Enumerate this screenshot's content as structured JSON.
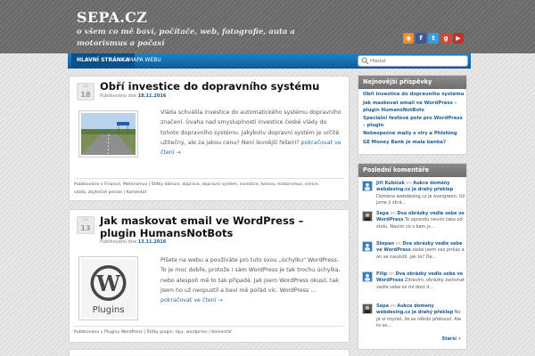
{
  "site": {
    "title": "SEPA.CZ",
    "tagline": "o všem co mě baví, počítače, web, fotografie, auta a motorismus a počasí"
  },
  "social_icons": [
    {
      "name": "rss-icon",
      "glyph": "◉",
      "color": "#f08c2a"
    },
    {
      "name": "facebook-icon",
      "glyph": "f",
      "color": "#3b5998"
    },
    {
      "name": "twitter-icon",
      "glyph": "t",
      "color": "#3a9ed9"
    },
    {
      "name": "googleplus-icon",
      "glyph": "g",
      "color": "#d34836"
    },
    {
      "name": "youtube-icon",
      "glyph": "▶",
      "color": "#c4302b"
    }
  ],
  "nav": {
    "home": "HLAVNÍ STRÁNKA",
    "map": "MAPA WEBU"
  },
  "search": {
    "placeholder": "Hledat"
  },
  "posts": [
    {
      "month": "Lis",
      "day": "18",
      "title": "Obří investice do dopravního systému",
      "meta_prefix": "Publikováno dne",
      "date": "18.11.2016",
      "excerpt": "Vláda schválila investice do automatického systému dopravního značení. Úvaha nad smysluplností investice české vlády do tohoto dopravního systému. Jakýkoliv dopravní systém je určitě užitečný, ale za jakou cenu? Není levnější řešení?",
      "more": "pokračovat ve čtení →",
      "foot_line1": "Publikováno v Finance, Motorismus | Štítky dálnice, doprava, dopravní systém, investice, kolona, motorismus, silnice,",
      "foot_line2": "vláda, zbytečné peníze | Komentář"
    },
    {
      "month": "Lis",
      "day": "13",
      "title": "Jak maskovat email ve WordPress – plugin HumansNotBots",
      "meta_prefix": "Publikováno dne",
      "date": "13.11.2016",
      "excerpt": "Píšete na webu a používáte pro tuto svou „úchylku\" WordPress. To je moc dobře, protože i sám WordPress je tak trochu úchylka, nebo alespoň mě to tak připadá. Jak jsem WordPress okusil, tak jsem ho už neopustil a baví mě pořád víc. WordPress …",
      "more": "pokračovat ve čtení →",
      "foot_line1": "Publikováno v Pluginy WordPress | Štítky plugin, tipy, wordpress | Komentář",
      "plugin_label": "Plugins"
    }
  ],
  "widgets": {
    "recent_posts": {
      "title": "Nejnovější příspěvky",
      "items": [
        "Obří investice do dopravního systému",
        "Jak maskovat email ve WordPress – plugin HumansNotBots",
        "Speciální fesťová pole pro WordPress – plugin",
        "Nebezpečné maily s viry a Phishing",
        "GE Money Bank je mala banka?"
      ]
    },
    "recent_comments": {
      "title": "Poslední komentáře",
      "items": [
        {
          "author": "Jiří Kubíček",
          "on": "on",
          "post": "Aukce domény webdesing.cz je drahý překlep",
          "text": "Doména webdesing.cz je evergreen. Už jsme ji zkrá..."
        },
        {
          "author": "Sepa",
          "on": "on",
          "post": "Dva obrázky vedle sebe ve WordPress",
          "text": "To opravdu nevím tako od stolu. Navím co s kam js..."
        },
        {
          "author": "Stepan",
          "on": "on",
          "post": "Dva obrázky vedle sebe ve WordPress",
          "text": "zadal jsem vas prikaz a on se nauložil. jak to? De..."
        },
        {
          "author": "Filip",
          "on": "on",
          "post": "Dva obrázky vedle sebe ve WordPress",
          "text": "Zdravím, obrázky zarovnat vedle sebe se mi dost d..."
        },
        {
          "author": "Sepa",
          "on": "on",
          "post": "Aukce domény webdesing.cz je drahý překlep",
          "text": "No já ví myslel, že se někdo překousl. Ale to se..."
        }
      ],
      "older": "Starší »"
    }
  }
}
